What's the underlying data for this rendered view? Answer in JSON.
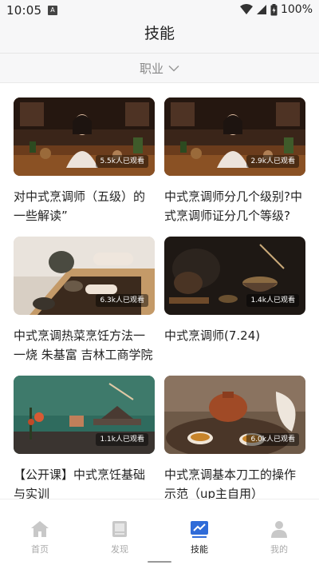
{
  "status": {
    "time": "10:05",
    "notif": "A",
    "battery": "100%"
  },
  "header": {
    "title": "技能"
  },
  "filter": {
    "label": "职业"
  },
  "cards": [
    {
      "title": "对中式烹调师（五级）的一些解读”",
      "views": "5.5k人已观看"
    },
    {
      "title": "中式烹调师分几个级别?中式烹调师证分几个等级?",
      "views": "2.9k人已观看"
    },
    {
      "title": "中式烹调热菜烹饪方法一一烧 朱基富 吉林工商学院",
      "views": "6.3k人已观看"
    },
    {
      "title": "中式烹调师(7.24)",
      "views": "1.4k人已观看"
    },
    {
      "title": "【公开课】中式烹饪基础与实训",
      "views": "1.1k人已观看"
    },
    {
      "title": "中式烹调基本刀工的操作示范（up主自用）",
      "views": "6.0k人已观看"
    }
  ],
  "nav": {
    "items": [
      {
        "label": "首页",
        "icon": "home-icon"
      },
      {
        "label": "发现",
        "icon": "book-icon"
      },
      {
        "label": "技能",
        "icon": "chart-icon"
      },
      {
        "label": "我的",
        "icon": "user-icon"
      }
    ],
    "active_index": 2
  },
  "colors": {
    "accent": "#2f6bd8",
    "inactive": "#c8c8c8"
  }
}
